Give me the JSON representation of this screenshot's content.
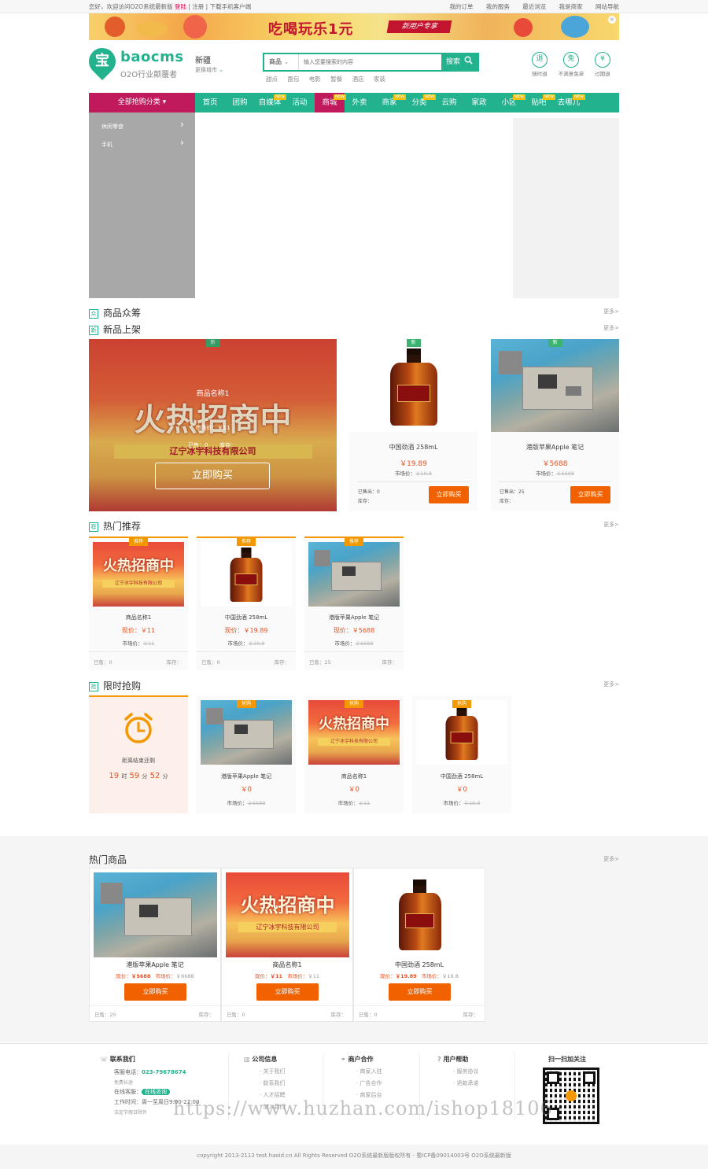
{
  "topbar": {
    "greeting": "您好，欢迎访问O2O系统最新版",
    "login": "登陆",
    "sep": "|",
    "register": "注册",
    "download": "下载手机客户端",
    "links": [
      "我的订单",
      "我的服务",
      "最近浏览",
      "我是商家",
      "网站导航"
    ]
  },
  "banner": {
    "main": "吃喝玩乐1元",
    "sub": "新用户专享",
    "close": "×"
  },
  "header": {
    "logo_char": "宝",
    "logo_name": "baocms",
    "slogan": "O2O行业颠覆者",
    "city": "新疆",
    "city_switch": "更换城市",
    "search_type": "商品",
    "search_placeholder": "输入您要搜索的内容",
    "search_btn": "搜索",
    "hotwords": [
      "甜点",
      "面包",
      "电影",
      "暂餐",
      "酒店",
      "家装"
    ],
    "promises": [
      {
        "icon": "退",
        "label": "随时退"
      },
      {
        "icon": "免",
        "label": "不满意免单"
      },
      {
        "icon": "¥",
        "label": "过期退"
      }
    ]
  },
  "nav": {
    "all": "全部抢购分类",
    "items": [
      {
        "label": "首页",
        "new": ""
      },
      {
        "label": "团购",
        "new": ""
      },
      {
        "label": "自媒体",
        "new": "NEW"
      },
      {
        "label": "活动",
        "new": ""
      },
      {
        "label": "商城",
        "new": "NEW"
      },
      {
        "label": "外卖",
        "new": ""
      },
      {
        "label": "商家",
        "new": "NEW"
      },
      {
        "label": "分类",
        "new": "NEW"
      },
      {
        "label": "云购",
        "new": ""
      },
      {
        "label": "家政",
        "new": ""
      },
      {
        "label": "小区",
        "new": "NEW"
      },
      {
        "label": "贴吧",
        "new": "NEW"
      },
      {
        "label": "去哪儿",
        "new": "NEW"
      }
    ]
  },
  "sidemenu": {
    "items": [
      "休闲零食",
      "手机"
    ]
  },
  "sections": {
    "crowdfund": {
      "icon": "众",
      "title": "商品众筹",
      "more": "更多>"
    },
    "newarrival": {
      "icon": "新",
      "title": "新品上架",
      "more": "更多>"
    },
    "hot": {
      "icon": "荐",
      "title": "热门推荐",
      "more": "更多>"
    },
    "flash": {
      "icon": "抢",
      "title": "限时抢购",
      "more": "更多>"
    },
    "hotgoods": {
      "title": "热门商品",
      "more": "更多>"
    }
  },
  "big_banner": {
    "tag": "新",
    "main": "火热招商中",
    "company": "辽宁冰宇科技有限公司",
    "product_name": "商品名称1",
    "mprice": "市场价：￥11",
    "sold": "已售：0",
    "stock": "库存：",
    "buy": "立即购买"
  },
  "new_cards": [
    {
      "tag": "新",
      "name": "中国劲酒 258mL",
      "price": "￥19.89",
      "mprice_label": "市场价：",
      "mprice": "￥19.8",
      "sold": "已售出：0",
      "stock": "库存：",
      "buy": "立即购买"
    },
    {
      "tag": "新",
      "name": "港版苹果Apple 笔记",
      "price": "￥5688",
      "mprice_label": "市场价：",
      "mprice": "￥6688",
      "sold": "已售出：25",
      "stock": "库存：",
      "buy": "立即购买"
    }
  ],
  "hot_cards": [
    {
      "tag": "推荐",
      "name": "商品名称1",
      "price": "现价：￥11",
      "mprice_label": "市场价：",
      "mprice": "￥11",
      "sold": "已售：0",
      "stock": "库存："
    },
    {
      "tag": "推荐",
      "name": "中国劲酒 258mL",
      "price": "现价：￥19.89",
      "mprice_label": "市场价：",
      "mprice": "￥19.8",
      "sold": "已售：0",
      "stock": "库存："
    },
    {
      "tag": "推荐",
      "name": "港版苹果Apple 笔记",
      "price": "现价：￥5688",
      "mprice_label": "市场价：",
      "mprice": "￥6688",
      "sold": "已售：25",
      "stock": "库存："
    }
  ],
  "flash": {
    "countdown_label": "距离结束还剩",
    "hours": "19",
    "h_unit": "时",
    "minutes": "59",
    "m_unit": "分",
    "seconds": "52",
    "s_unit": "分",
    "cards": [
      {
        "tag": "抢购",
        "name": "港版苹果Apple 笔记",
        "price": "￥0",
        "mprice_label": "市场价：",
        "mprice": "￥6688"
      },
      {
        "tag": "抢购",
        "name": "商品名称1",
        "price": "￥0",
        "mprice_label": "市场价：",
        "mprice": "￥11"
      },
      {
        "tag": "抢购",
        "name": "中国劲酒 258mL",
        "price": "￥0",
        "mprice_label": "市场价：",
        "mprice": "￥19.8"
      }
    ]
  },
  "hotgoods": [
    {
      "name": "港版苹果Apple 笔记",
      "price_label": "现价：",
      "price": "￥5688",
      "mprice_label": "市场价：",
      "mprice": "￥6688",
      "buy": "立即购买",
      "sold": "已售：25",
      "stock": "库存："
    },
    {
      "name": "商品名称1",
      "price_label": "现价：",
      "price": "￥11",
      "mprice_label": "市场价：",
      "mprice": "￥11",
      "buy": "立即购买",
      "sold": "已售：0",
      "stock": "库存："
    },
    {
      "name": "中国劲酒 258mL",
      "price_label": "现价：",
      "price": "￥19.89",
      "mprice_label": "市场价：",
      "mprice": "￥19.8",
      "buy": "立即购买",
      "sold": "已售：0",
      "stock": "库存："
    }
  ],
  "footer": {
    "contact": {
      "title": "联系我们",
      "phone_label": "客服电话：",
      "phone": "023-79678674",
      "free": "免费长途",
      "online_label": "在线客服：",
      "online_btn": "在线咨询",
      "hours_label": "工作时间：",
      "hours": "周一至周日9:00-22:00",
      "holiday": "法定节假日除外"
    },
    "company": {
      "title": "公司信息",
      "links": [
        "关于我们",
        "联系我们",
        "人才招聘",
        "加入我们"
      ]
    },
    "merchant": {
      "title": "商户合作",
      "links": [
        "商家入驻",
        "广告合作",
        "商家后台"
      ]
    },
    "help": {
      "title": "用户帮助",
      "links": [
        "服务协议",
        "退款承诺"
      ]
    },
    "qr_title": "扫一扫加关注"
  },
  "copyright": "copyright 2013-2113 test.haoid.cn All Rights Reserved O2O系统最新版版权所有 - 蜀ICP备09014003号 O2O系统最新版",
  "watermark": "https://www.huzhan.com/ishop18106",
  "colors": {
    "brand": "#22b28e",
    "accent": "#c0195c",
    "price": "#e8501f",
    "buy": "#f26100"
  }
}
